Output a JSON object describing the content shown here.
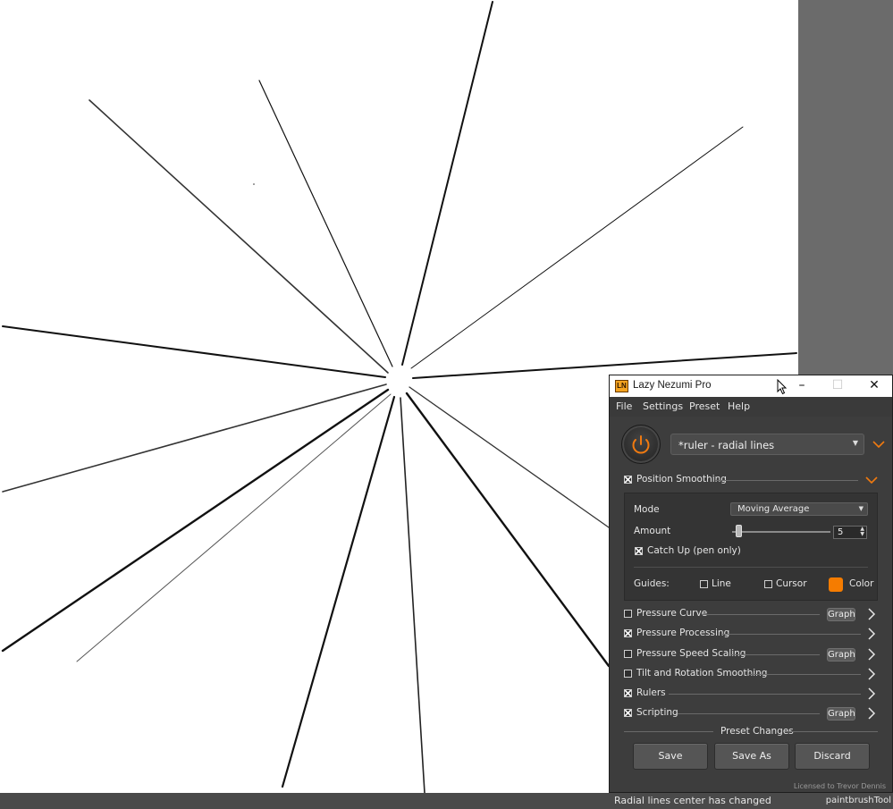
{
  "host": {
    "status_message": "Radial lines center has changed",
    "tool_name": "paintbrushTool"
  },
  "window": {
    "logo_text": "LN",
    "title": "Lazy Nezumi Pro"
  },
  "menu": [
    "File",
    "Settings",
    "Preset",
    "Help"
  ],
  "preset": {
    "current": "*ruler - radial lines"
  },
  "position_smoothing": {
    "label": "Position Smoothing",
    "checked": true,
    "mode_label": "Mode",
    "mode_value": "Moving Average",
    "amount_label": "Amount",
    "amount_value": "5",
    "amount_fraction": 0.04,
    "catch_up_label": "Catch Up (pen only)",
    "catch_up_checked": true,
    "guides_label": "Guides:",
    "guide_line_label": "Line",
    "guide_cursor_label": "Cursor",
    "guide_color_label": "Color",
    "guide_color": "#f57c00"
  },
  "sections": [
    {
      "label": "Pressure Curve",
      "checked": false,
      "graph": "Graph"
    },
    {
      "label": "Pressure Processing",
      "checked": true,
      "graph": ""
    },
    {
      "label": "Pressure Speed Scaling",
      "checked": false,
      "graph": "Graph"
    },
    {
      "label": "Tilt and Rotation Smoothing",
      "checked": false,
      "graph": ""
    },
    {
      "label": "Rulers",
      "checked": true,
      "graph": ""
    },
    {
      "label": "Scripting",
      "checked": true,
      "graph": "Graph"
    }
  ],
  "preset_changes": {
    "title": "Preset Changes",
    "save": "Save",
    "save_as": "Save As",
    "discard": "Discard"
  },
  "license": "Licensed to Trevor Dennis",
  "colors": {
    "accent": "#f57c00",
    "panel": "#3d3d3d",
    "canvas": "#ffffff",
    "workspace": "#6b6b6b"
  },
  "icons": [
    "power-icon",
    "chevron-down-icon",
    "chevron-right-icon",
    "minimize-icon",
    "maximize-icon",
    "close-icon",
    "mouse-cursor-icon"
  ]
}
